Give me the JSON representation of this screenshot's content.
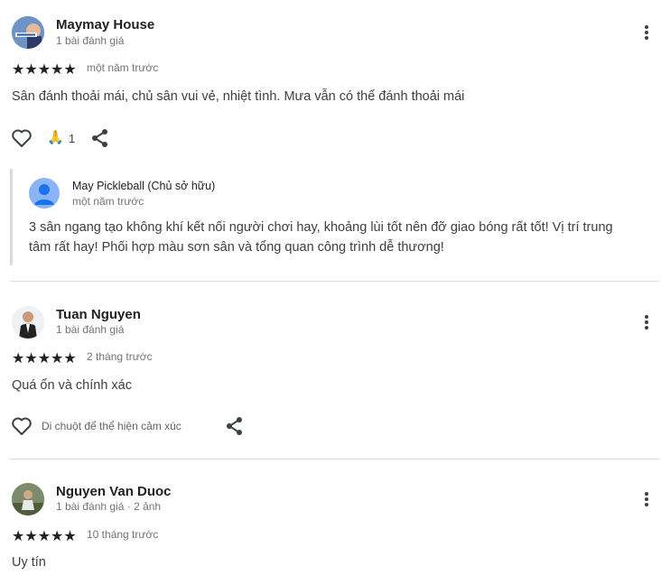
{
  "reviews": [
    {
      "name": "Maymay House",
      "meta": "1 bài đánh giá",
      "stars": "★★★★★",
      "date": "một năm trước",
      "text": "Sân đánh thoải mái, chủ sân vui vẻ, nhiệt tình. Mưa vẫn có thể đánh thoải mái",
      "reaction_count": "1",
      "reaction_emoji": "🙏",
      "owner_reply": {
        "name": "May Pickleball (Chủ sở hữu)",
        "date": "một năm trước",
        "text_line1": "3 sân ngang tạo không khí kết nối người chơi hay, khoảng lùi tốt nên đỡ giao bóng rất tốt! Vị trí trung",
        "text_line2": "tâm rất hay! Phối hợp màu sơn sân và tổng quan công trình dễ thương!"
      }
    },
    {
      "name": "Tuan Nguyen",
      "meta": "1 bài đánh giá",
      "stars": "★★★★★",
      "date": "2 tháng trước",
      "text": "Quá ổn và chính xác",
      "hover_hint": "Di chuột để thể hiện cảm xúc"
    },
    {
      "name": "Nguyen Van Duoc",
      "meta": "1 bài đánh giá · 2 ảnh",
      "stars": "★★★★★",
      "date": "10 tháng trước",
      "text": "Uy tín"
    }
  ],
  "colors": {
    "star": "#fbbc04",
    "divider": "#dadce0",
    "text": "#3c4043"
  },
  "icons": [
    "heart-icon",
    "share-icon",
    "more-vert-icon",
    "pray-emoji"
  ]
}
